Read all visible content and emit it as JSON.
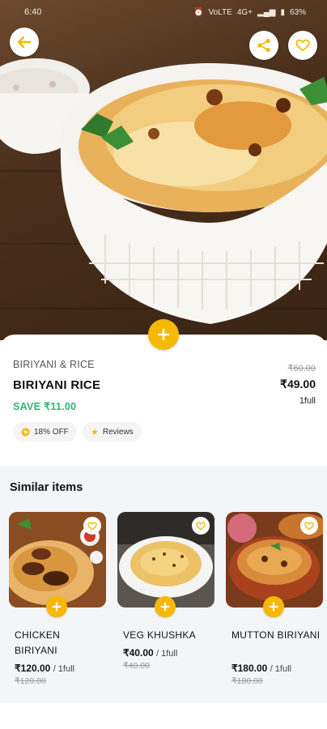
{
  "status_bar": {
    "time": "6:40",
    "network": "VoLTE",
    "data": "4G+",
    "battery": "63%"
  },
  "header": {
    "back_icon": "arrow-left-icon",
    "share_icon": "share-icon",
    "favorite_icon": "heart-outline-icon"
  },
  "product": {
    "category": "BIRIYANI & RICE",
    "name": "BIRIYANI RICE",
    "save_text": "SAVE ₹11.00",
    "mrp": "₹60.00",
    "price": "₹49.00",
    "unit": "1full",
    "add_icon": "plus-icon",
    "discount_chip": "18% OFF",
    "reviews_chip": "Reviews"
  },
  "similar": {
    "title": "Similar items",
    "items": [
      {
        "name": "CHICKEN BIRIYANI",
        "price": "₹120.00",
        "unit": "/ 1full",
        "mrp": "₹120.00"
      },
      {
        "name": "VEG KHUSHKA",
        "price": "₹40.00",
        "unit": "/ 1full",
        "mrp": "₹40.00"
      },
      {
        "name": "MUTTON BIRIYANI",
        "price": "₹180.00",
        "unit": "/ 1full",
        "mrp": "₹180.00"
      }
    ]
  },
  "colors": {
    "accent": "#f6b800",
    "save_green": "#2bb673",
    "text_dark": "#111111"
  }
}
